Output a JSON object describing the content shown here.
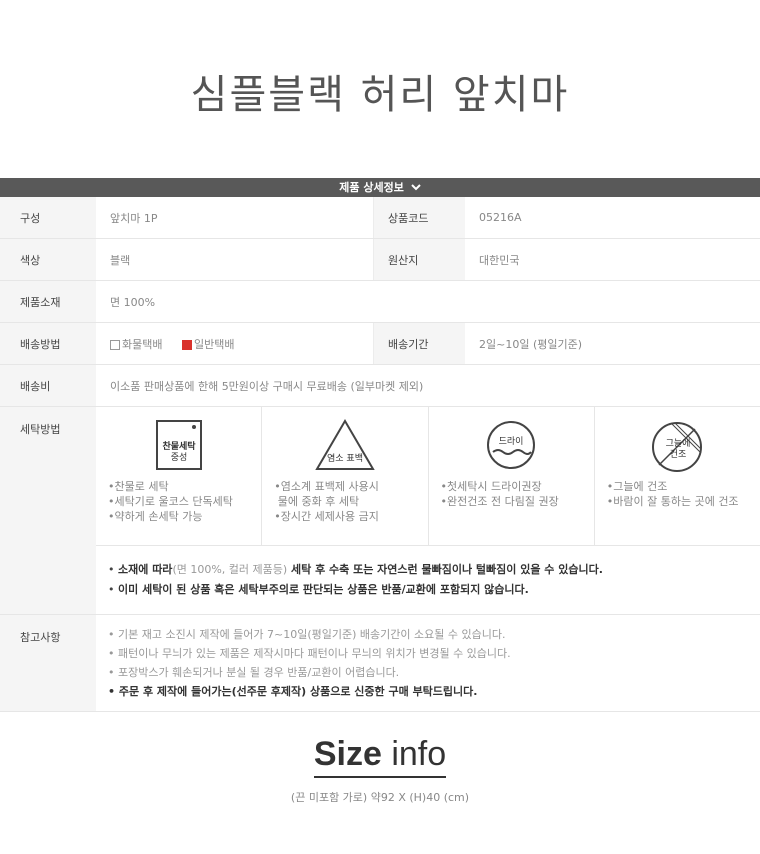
{
  "page_title": "심플블랙 허리 앞치마",
  "section_bar": "제품 상세정보",
  "spec": {
    "composition_label": "구성",
    "composition_value": "앞치마 1P",
    "code_label": "상품코드",
    "code_value": "05216A",
    "color_label": "색상",
    "color_value": "블랙",
    "origin_label": "원산지",
    "origin_value": "대한민국",
    "material_label": "제품소재",
    "material_value": "면 100%",
    "delivery_method_label": "배송방법",
    "delivery_option_1": "화물택배",
    "delivery_option_2": "일반택배",
    "delivery_period_label": "배송기간",
    "delivery_period_value": "2일~10일 (평일기준)",
    "shipping_fee_label": "배송비",
    "shipping_fee_value": "이소품 판매상품에 한해 5만원이상 구매시 무료배송 (일부마켓 제외)",
    "washing_label": "세탁방법",
    "reference_label": "참고사항"
  },
  "washing": [
    {
      "icon_text": [
        "찬물세탁",
        "중성"
      ],
      "lines": [
        "찬물로 세탁",
        "세탁기로 울코스 단독세탁",
        "약하게 손세탁 가능"
      ]
    },
    {
      "icon_text": [
        "염소 표백"
      ],
      "lines": [
        "염소계 표백제 사용시",
        "물에 중화 후 세탁",
        "장시간 세제사용 금지"
      ]
    },
    {
      "icon_text": [
        "드라이"
      ],
      "lines": [
        "첫세탁시 드라이권장",
        "완전건조 전 다림질 권장"
      ]
    },
    {
      "icon_text": [
        "그늘에",
        "건조"
      ],
      "lines": [
        "그늘에 건조",
        "바람이 잘 통하는 곳에 건조"
      ]
    }
  ],
  "wash_notes": {
    "note1_a": "소재에 따라",
    "note1_b": "(면 100%, 컬러 제품등)",
    "note1_c": " 세탁 후 수축 또는 자연스런 물빠짐이나 털빠짐이 있을 수 있습니다.",
    "note2": "이미 세탁이 된 상품 혹은 세탁부주의로 판단되는 상품은 반품/교환에 포함되지 않습니다."
  },
  "reference": [
    "기본 재고 소진시 제작에 들어가 7~10일(평일기준) 배송기간이 소요될 수 있습니다.",
    "패턴이나 무늬가 있는 제품은 제작시마다 패턴이나 무늬의 위치가 변경될 수 있습니다.",
    "포장박스가 훼손되거나 분실 될 경우 반품/교환이 어렵습니다.",
    "주문 후 제작에 들어가는(선주문 후제작) 상품으로 신중한 구매 부탁드립니다."
  ],
  "size": {
    "title_bold": "Size",
    "title_light": "info",
    "subtitle": "(끈 미포함 가로) 약92 X (H)40 (cm)"
  },
  "colors": {
    "bar": "#595959",
    "label_bg": "#f5f5f5",
    "selected_box": "#d9312b"
  },
  "icons": [
    "chevron-down-icon",
    "washtub-icon",
    "triangle-bleach-icon",
    "dryclean-circle-icon",
    "shade-dry-icon"
  ]
}
